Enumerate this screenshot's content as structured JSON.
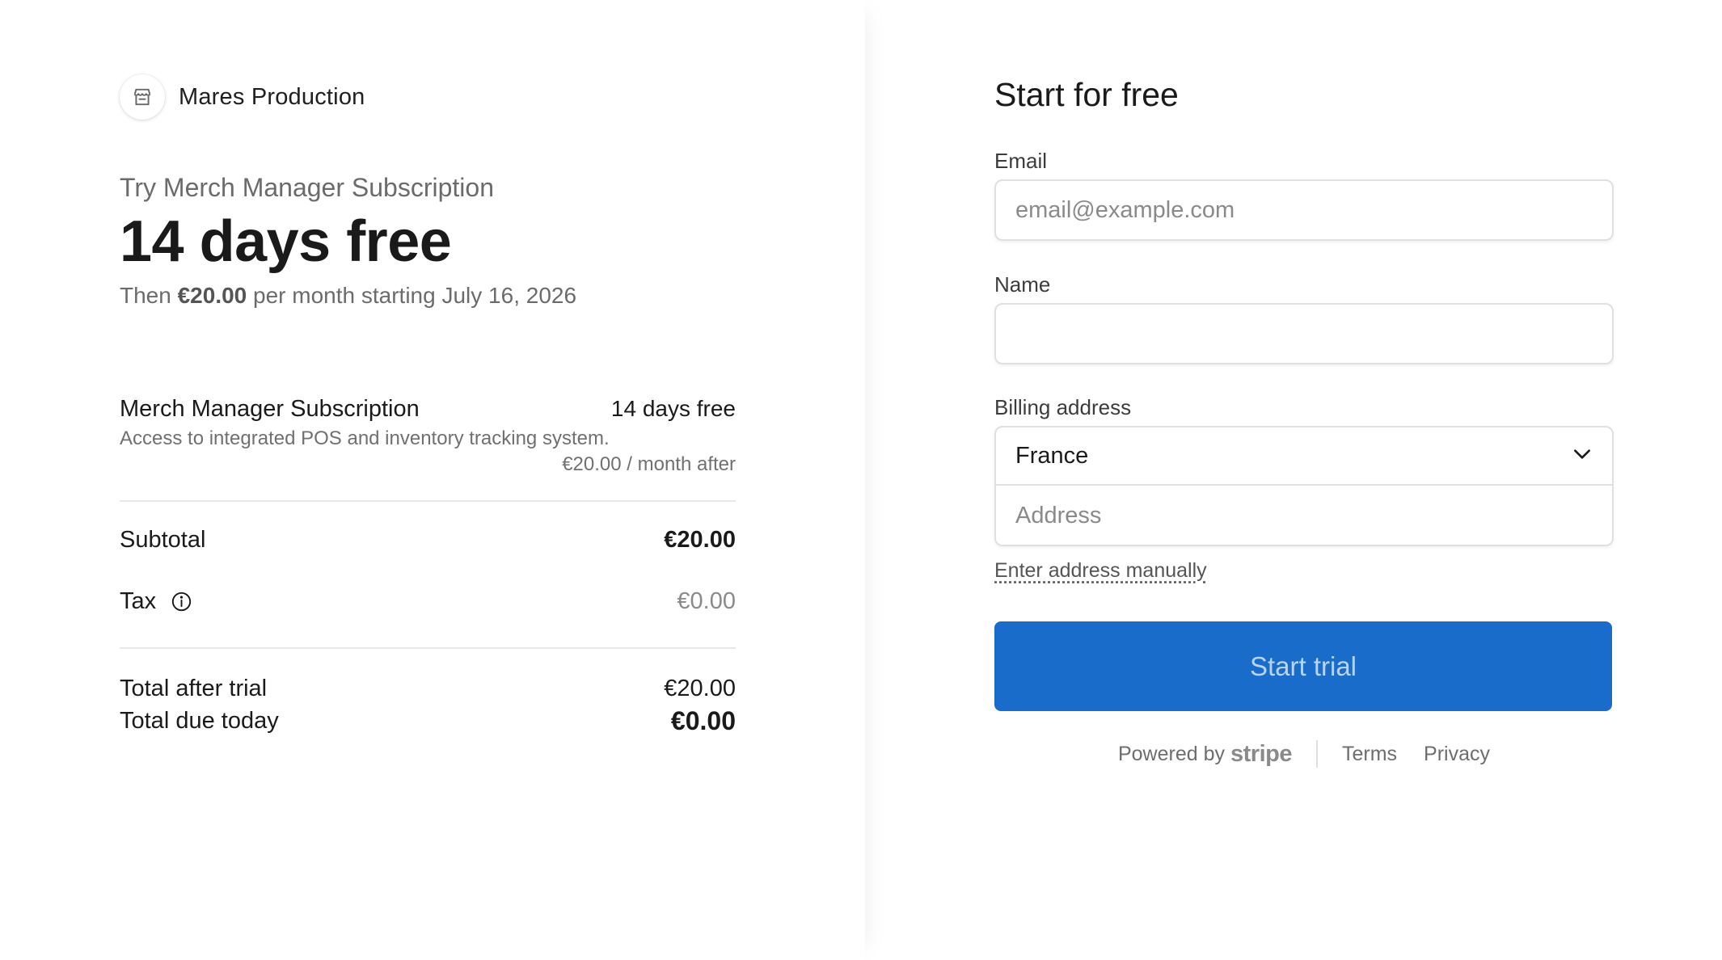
{
  "merchant": {
    "name": "Mares Production",
    "logo_icon": "storefront-icon"
  },
  "summary": {
    "eyebrow": "Try Merch Manager Subscription",
    "headline": "14 days free",
    "then_prefix": "Then",
    "then_price": "€20.00",
    "then_suffix": "per month starting July 16, 2026"
  },
  "line_item": {
    "name": "Merch Manager Subscription",
    "amount": "14 days free",
    "description": "Access to integrated POS and inventory tracking system.",
    "after": "€20.00 / month after"
  },
  "totals": {
    "subtotal_label": "Subtotal",
    "subtotal_value": "€20.00",
    "tax_label": "Tax",
    "tax_value": "€0.00",
    "after_trial_label": "Total after trial",
    "after_trial_value": "€20.00",
    "due_today_label": "Total due today",
    "due_today_value": "€0.00"
  },
  "form": {
    "title": "Start for free",
    "email_label": "Email",
    "email_placeholder": "email@example.com",
    "name_label": "Name",
    "name_value": "",
    "billing_label": "Billing address",
    "country_value": "France",
    "address_placeholder": "Address",
    "manual_link": "Enter address manually",
    "submit_label": "Start trial"
  },
  "footer": {
    "powered_by": "Powered by",
    "brand": "stripe",
    "terms": "Terms",
    "privacy": "Privacy"
  },
  "colors": {
    "button_bg": "#1a6ccb",
    "button_text": "#b9d3f2",
    "muted_text": "#6b6b6b",
    "border": "#e0e0e0"
  }
}
